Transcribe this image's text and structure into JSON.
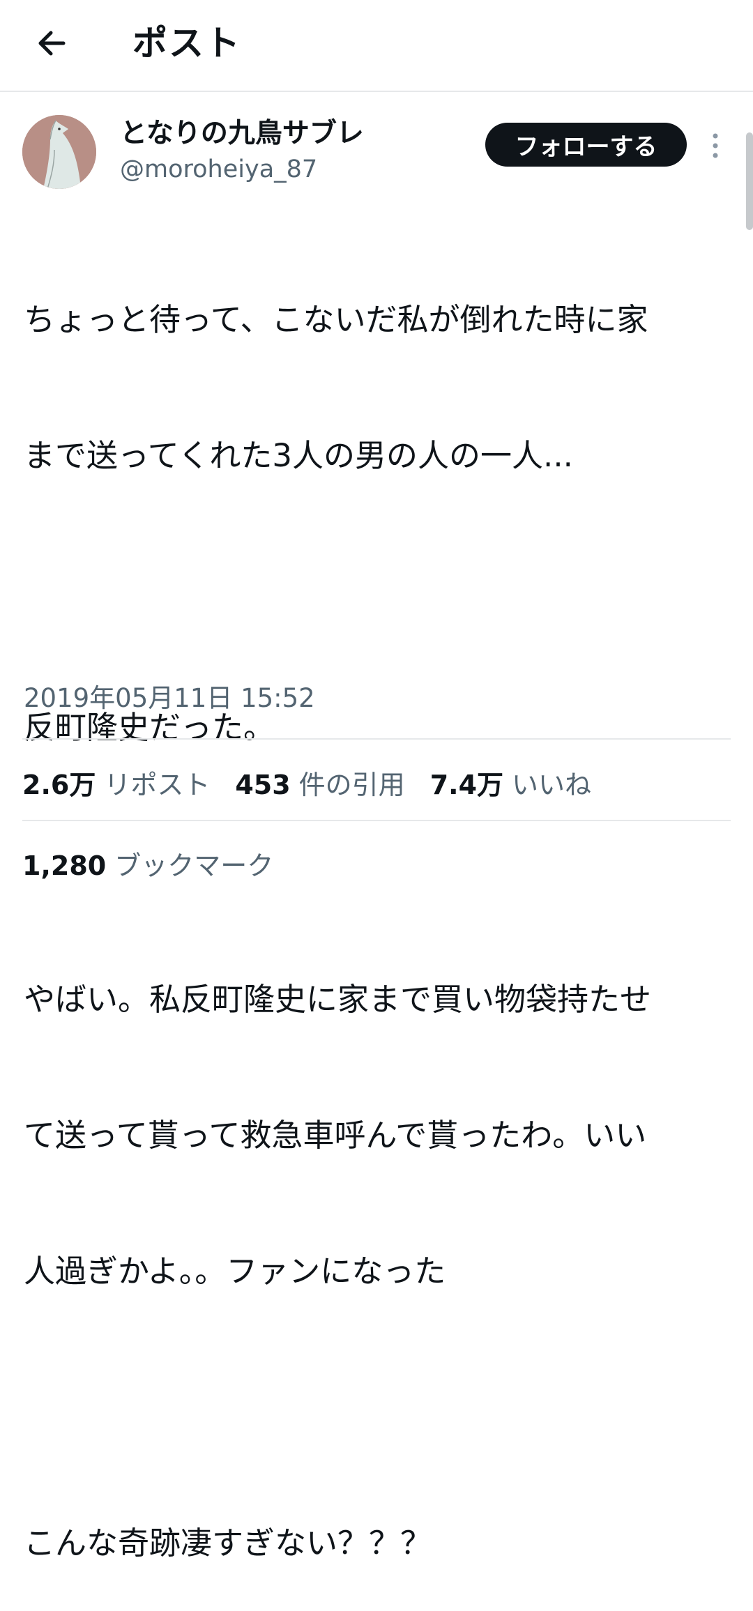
{
  "header": {
    "title": "ポスト",
    "back_icon": "arrow-left-icon"
  },
  "author": {
    "display_name": "となりの九鳥サブレ",
    "handle": "@moroheiya_87",
    "avatar_colors": {
      "background": "#b88f86",
      "bird": "#dfe8e6"
    }
  },
  "follow_button": {
    "label": "フォローする"
  },
  "more_icon": "more-vertical-icon",
  "tweet": {
    "lines": [
      "ちょっと待って、こないだ私が倒れた時に家",
      "まで送ってくれた3人の男の人の一人...",
      "",
      "反町隆史だった。",
      "",
      "やばい。私反町隆史に家まで買い物袋持たせ",
      "て送って貰って救急車呼んで貰ったわ。いい",
      "人過ぎかよ。。ファンになった",
      "",
      "こんな奇跡凄すぎない？？？"
    ],
    "timestamp": "2019年05月11日 15:52"
  },
  "stats": {
    "reposts": {
      "count": "2.6万",
      "label": "リポスト"
    },
    "quotes": {
      "count": "453",
      "label": "件の引用"
    },
    "likes": {
      "count": "7.4万",
      "label": "いいね"
    },
    "bookmarks": {
      "count": "1,280",
      "label": "ブックマーク"
    }
  },
  "colors": {
    "text_primary": "#0f1419",
    "text_secondary": "#536471",
    "divider": "#e6e8ea",
    "follow_bg": "#0f1419",
    "follow_text": "#ffffff"
  }
}
